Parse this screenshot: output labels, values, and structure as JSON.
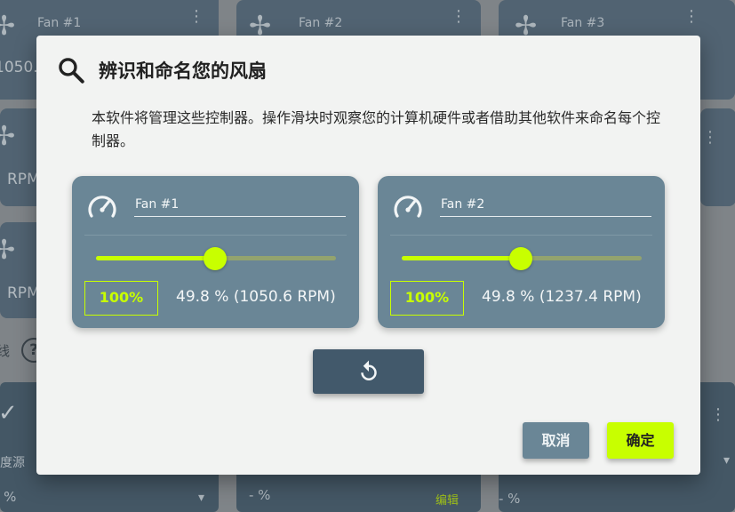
{
  "background": {
    "cards": [
      {
        "title": "Fan #1",
        "value": "1050."
      },
      {
        "title": "Fan #2"
      },
      {
        "title": "Fan #3"
      }
    ],
    "rpm_partial": "RPM",
    "side_text": "线",
    "help_glyph": "?",
    "source_label": "度源",
    "pct_label": "- %",
    "edit_label": "编辑"
  },
  "dialog": {
    "title": "辨识和命名您的风扇",
    "description": "本软件将管理这些控制器。操作滑块时观察您的计算机硬件或者借助其他软件来命名每个控制器。",
    "fans": [
      {
        "name": "Fan #1",
        "percent_label": "100%",
        "speed_percent": 49.8,
        "reading": "49.8 %  (1050.6 RPM)"
      },
      {
        "name": "Fan #2",
        "percent_label": "100%",
        "speed_percent": 49.8,
        "reading": "49.8 %  (1237.4 RPM)"
      }
    ],
    "reset_icon": "reset-icon",
    "cancel_label": "取消",
    "ok_label": "确定"
  },
  "colors": {
    "accent": "#c8ff00",
    "card": "#6a8696",
    "dialog_bg": "#f2f3f2",
    "app_card": "#4e6577"
  }
}
